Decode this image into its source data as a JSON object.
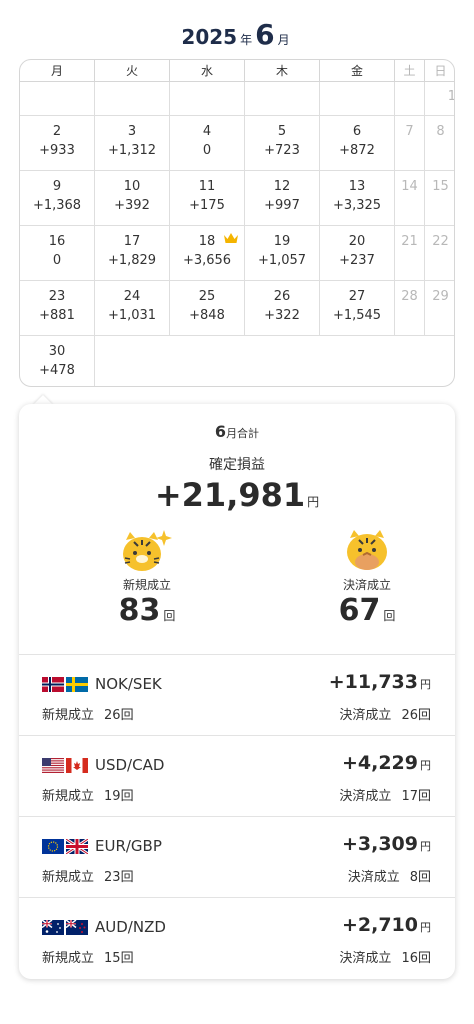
{
  "header": {
    "year": "2025",
    "year_unit": "年",
    "month": "6",
    "month_unit": "月"
  },
  "calendar": {
    "weekdays": [
      "月",
      "火",
      "水",
      "木",
      "金",
      "土",
      "日"
    ],
    "weeks": [
      [
        {
          "d": "",
          "v": ""
        },
        {
          "d": "",
          "v": ""
        },
        {
          "d": "",
          "v": ""
        },
        {
          "d": "",
          "v": ""
        },
        {
          "d": "",
          "v": ""
        },
        {
          "d": "",
          "v": ""
        },
        {
          "d": "1",
          "v": ""
        }
      ],
      [
        {
          "d": "2",
          "v": "+933"
        },
        {
          "d": "3",
          "v": "+1,312"
        },
        {
          "d": "4",
          "v": "0"
        },
        {
          "d": "5",
          "v": "+723"
        },
        {
          "d": "6",
          "v": "+872"
        },
        {
          "d": "7",
          "v": ""
        },
        {
          "d": "8",
          "v": ""
        }
      ],
      [
        {
          "d": "9",
          "v": "+1,368"
        },
        {
          "d": "10",
          "v": "+392"
        },
        {
          "d": "11",
          "v": "+175"
        },
        {
          "d": "12",
          "v": "+997"
        },
        {
          "d": "13",
          "v": "+3,325"
        },
        {
          "d": "14",
          "v": ""
        },
        {
          "d": "15",
          "v": ""
        }
      ],
      [
        {
          "d": "16",
          "v": "0"
        },
        {
          "d": "17",
          "v": "+1,829"
        },
        {
          "d": "18",
          "v": "+3,656",
          "crown": true
        },
        {
          "d": "19",
          "v": "+1,057"
        },
        {
          "d": "20",
          "v": "+237"
        },
        {
          "d": "21",
          "v": ""
        },
        {
          "d": "22",
          "v": ""
        }
      ],
      [
        {
          "d": "23",
          "v": "+881"
        },
        {
          "d": "24",
          "v": "+1,031"
        },
        {
          "d": "25",
          "v": "+848"
        },
        {
          "d": "26",
          "v": "+322"
        },
        {
          "d": "27",
          "v": "+1,545"
        },
        {
          "d": "28",
          "v": ""
        },
        {
          "d": "29",
          "v": ""
        }
      ],
      [
        {
          "d": "30",
          "v": "+478"
        }
      ]
    ],
    "best_day_icon": "crown-icon",
    "crown_color": "#f4b400"
  },
  "summary": {
    "month_number": "6",
    "month_total_label": "月合計",
    "fixed_profit_label": "確定損益",
    "total_amount": "+21,981",
    "yen": "円",
    "new_label": "新規成立",
    "new_count": "83",
    "close_label": "決済成立",
    "close_count": "67",
    "count_unit": "回",
    "mascot_new_icon": "tiger-mascot-sparkle-icon",
    "mascot_close_icon": "tiger-mascot-moneybag-icon",
    "mascot_color": "#f6c12c"
  },
  "pairs": [
    {
      "name": "NOK/SEK",
      "flags": [
        "norway-flag-icon",
        "sweden-flag-icon"
      ],
      "profit": "+11,733",
      "yen": "円",
      "new_label": "新規成立",
      "new_count": "26",
      "close_label": "決済成立",
      "close_count": "26",
      "unit": "回"
    },
    {
      "name": "USD/CAD",
      "flags": [
        "usa-flag-icon",
        "canada-flag-icon"
      ],
      "profit": "+4,229",
      "yen": "円",
      "new_label": "新規成立",
      "new_count": "19",
      "close_label": "決済成立",
      "close_count": "17",
      "unit": "回"
    },
    {
      "name": "EUR/GBP",
      "flags": [
        "eu-flag-icon",
        "uk-flag-icon"
      ],
      "profit": "+3,309",
      "yen": "円",
      "new_label": "新規成立",
      "new_count": "23",
      "close_label": "決済成立",
      "close_count": "8",
      "unit": "回"
    },
    {
      "name": "AUD/NZD",
      "flags": [
        "australia-flag-icon",
        "newzealand-flag-icon"
      ],
      "profit": "+2,710",
      "yen": "円",
      "new_label": "新規成立",
      "new_count": "15",
      "close_label": "決済成立",
      "close_count": "16",
      "unit": "回"
    }
  ]
}
